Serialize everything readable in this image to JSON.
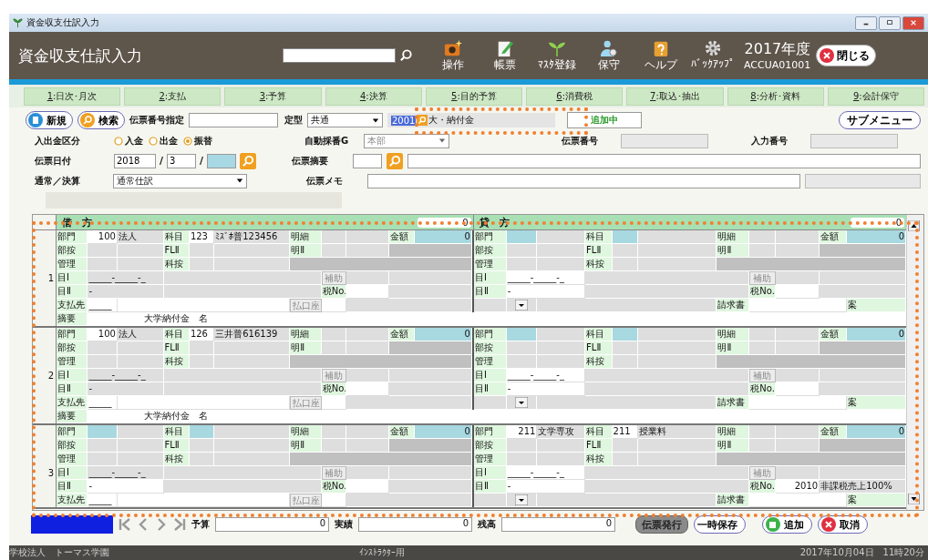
{
  "window": {
    "title": "資金収支仕訳入力"
  },
  "header": {
    "title": "資金収支仕訳入力",
    "tools": [
      {
        "label": "操作"
      },
      {
        "label": "帳票"
      },
      {
        "label": "ﾏｽﾀ登録"
      },
      {
        "label": "保守"
      },
      {
        "label": "ヘルプ"
      },
      {
        "label": "ﾊﾞｯｸｱｯﾌﾟ"
      }
    ],
    "fiscal_year": "2017年度",
    "screen_code": "ACCUA01001",
    "close_button": "閉じる"
  },
  "tabs": [
    {
      "key": "1",
      "label": ":日次･月次",
      "selected": false
    },
    {
      "key": "2",
      "label": ":支払",
      "selected": false
    },
    {
      "key": "3",
      "label": ":予算",
      "selected": false
    },
    {
      "key": "4",
      "label": ":決算",
      "selected": false
    },
    {
      "key": "5",
      "label": ":目的予算",
      "selected": false
    },
    {
      "key": "6",
      "label": ":消費税",
      "selected": false
    },
    {
      "key": "7",
      "label": ":取込･抽出",
      "selected": false
    },
    {
      "key": "8",
      "label": ":分析･資料",
      "selected": false
    },
    {
      "key": "9",
      "label": ":会計保守",
      "selected": false
    }
  ],
  "form": {
    "new_button": "新規",
    "search_button": "検索",
    "voucher_no_label": "伝票番号指定",
    "template_label": "定型",
    "template": "共通",
    "template_code": "2001",
    "template_name": "大・納付金",
    "status": "追加中",
    "submenu_button": "サブメニュー",
    "io_label": "入出金区分",
    "io_options": [
      {
        "label": "入金",
        "selected": false
      },
      {
        "label": "出金",
        "selected": false
      },
      {
        "label": "振替",
        "selected": true
      }
    ],
    "auto_label": "自動採番G",
    "auto_group": "本部",
    "slip_no_label": "伝票番号",
    "input_no_label": "入力番号",
    "date_label": "伝票日付",
    "year": "2018",
    "sep1": "/",
    "month": "3",
    "sep2": "/",
    "summary_label": "伝票摘要",
    "type_label": "通常／決算",
    "type": "通常仕訳",
    "memo_label": "伝票メモ"
  },
  "grid": {
    "debit_label": "借　方",
    "debit_total": "0",
    "credit_label": "貸　方",
    "credit_total": "0",
    "entries": [
      {
        "number": "1",
        "debit": [
          [
            {
              "kind": "label",
              "text": "部門"
            },
            {
              "kind": "number",
              "text": "100"
            },
            {
              "kind": "field",
              "text": "法人"
            },
            {
              "kind": "label",
              "text": "科目"
            },
            {
              "kind": "input",
              "text": "123"
            },
            {
              "kind": "field",
              "text": "ﾐｽﾞﾎ普123456"
            },
            {
              "kind": "label",
              "text": "明細"
            },
            {
              "kind": "field"
            },
            {
              "kind": "field"
            },
            {
              "kind": "label",
              "text": "金額"
            },
            {
              "kind": "amount",
              "text": "0"
            }
          ],
          [
            {
              "kind": "label",
              "text": "部按"
            },
            {
              "kind": "field"
            },
            {
              "kind": "field"
            },
            {
              "kind": "label",
              "text": "FLⅡ"
            },
            {
              "kind": "field"
            },
            {
              "kind": "field"
            },
            {
              "kind": "label",
              "text": "明Ⅱ"
            },
            {
              "kind": "field"
            },
            {
              "kind": "field"
            },
            {
              "kind": "dark"
            }
          ],
          [
            {
              "kind": "label",
              "text": "管理"
            },
            {
              "kind": "field"
            },
            {
              "kind": "field"
            },
            {
              "kind": "label",
              "text": "科按"
            },
            {
              "kind": "field"
            },
            {
              "kind": "field"
            },
            {
              "kind": "dark"
            }
          ],
          [
            {
              "kind": "label",
              "text": "目Ⅰ"
            },
            {
              "kind": "field",
              "text": "_____-_____-_"
            },
            {
              "kind": "field"
            },
            {
              "kind": "button",
              "text": "補助"
            },
            {
              "kind": "field"
            },
            {
              "kind": "field"
            }
          ],
          [
            {
              "kind": "label",
              "text": "目Ⅱ"
            },
            {
              "kind": "field",
              "text": "-"
            },
            {
              "kind": "field"
            },
            {
              "kind": "label",
              "text": "税No."
            },
            {
              "kind": "input"
            },
            {
              "kind": "field"
            }
          ],
          [
            {
              "kind": "label",
              "text": "支払先"
            },
            {
              "kind": "input",
              "text": "_____"
            },
            {
              "kind": "input"
            },
            {
              "kind": "button",
              "text": "払口座"
            },
            {
              "kind": "input"
            },
            {
              "kind": "field"
            }
          ]
        ],
        "credit": [
          [
            {
              "kind": "label",
              "text": "部門"
            },
            {
              "kind": "tinted"
            },
            {
              "kind": "field"
            },
            {
              "kind": "label",
              "text": "科目"
            },
            {
              "kind": "tinted"
            },
            {
              "kind": "field"
            },
            {
              "kind": "label",
              "text": "明細"
            },
            {
              "kind": "field"
            },
            {
              "kind": "field"
            },
            {
              "kind": "label",
              "text": "金額"
            },
            {
              "kind": "amount",
              "text": "0"
            }
          ],
          [
            {
              "kind": "label",
              "text": "部按"
            },
            {
              "kind": "field"
            },
            {
              "kind": "field"
            },
            {
              "kind": "label",
              "text": "FLⅡ"
            },
            {
              "kind": "field"
            },
            {
              "kind": "field"
            },
            {
              "kind": "label",
              "text": "明Ⅱ"
            },
            {
              "kind": "field"
            },
            {
              "kind": "field"
            },
            {
              "kind": "dark"
            }
          ],
          [
            {
              "kind": "label",
              "text": "管理"
            },
            {
              "kind": "field"
            },
            {
              "kind": "field"
            },
            {
              "kind": "label",
              "text": "科按"
            },
            {
              "kind": "field"
            },
            {
              "kind": "field"
            },
            {
              "kind": "dark"
            }
          ],
          [
            {
              "kind": "label",
              "text": "目Ⅰ"
            },
            {
              "kind": "input",
              "text": "_____-_____-_"
            },
            {
              "kind": "field"
            },
            {
              "kind": "button",
              "text": "補助"
            },
            {
              "kind": "field"
            },
            {
              "kind": "field"
            }
          ],
          [
            {
              "kind": "label",
              "text": "目Ⅱ"
            },
            {
              "kind": "input",
              "text": "-"
            },
            {
              "kind": "field"
            },
            {
              "kind": "label",
              "text": "税No."
            },
            {
              "kind": "input"
            },
            {
              "kind": "field"
            }
          ],
          [
            {
              "kind": "field"
            },
            {
              "kind": "dropdown"
            },
            {
              "kind": "field"
            },
            {
              "kind": "label",
              "text": "請求書"
            },
            {
              "kind": "input"
            },
            {
              "kind": "label",
              "text": "案"
            }
          ]
        ],
        "summary": {
          "label": "摘要",
          "text": "大学納付金　名"
        }
      },
      {
        "number": "2",
        "debit": [
          [
            {
              "kind": "label",
              "text": "部門"
            },
            {
              "kind": "number",
              "text": "100"
            },
            {
              "kind": "field",
              "text": "法人"
            },
            {
              "kind": "label",
              "text": "科目"
            },
            {
              "kind": "input",
              "text": "126"
            },
            {
              "kind": "field",
              "text": "三井普616139"
            },
            {
              "kind": "label",
              "text": "明細"
            },
            {
              "kind": "field"
            },
            {
              "kind": "field"
            },
            {
              "kind": "label",
              "text": "金額"
            },
            {
              "kind": "amount",
              "text": "0"
            }
          ],
          [
            {
              "kind": "label",
              "text": "部按"
            },
            {
              "kind": "field"
            },
            {
              "kind": "field"
            },
            {
              "kind": "label",
              "text": "FLⅡ"
            },
            {
              "kind": "field"
            },
            {
              "kind": "field"
            },
            {
              "kind": "label",
              "text": "明Ⅱ"
            },
            {
              "kind": "field"
            },
            {
              "kind": "field"
            },
            {
              "kind": "dark"
            }
          ],
          [
            {
              "kind": "label",
              "text": "管理"
            },
            {
              "kind": "field"
            },
            {
              "kind": "field"
            },
            {
              "kind": "label",
              "text": "科按"
            },
            {
              "kind": "field"
            },
            {
              "kind": "field"
            },
            {
              "kind": "dark"
            }
          ],
          [
            {
              "kind": "label",
              "text": "目Ⅰ"
            },
            {
              "kind": "field",
              "text": "_____-_____-_"
            },
            {
              "kind": "field"
            },
            {
              "kind": "button",
              "text": "補助"
            },
            {
              "kind": "field"
            },
            {
              "kind": "field"
            }
          ],
          [
            {
              "kind": "label",
              "text": "目Ⅱ"
            },
            {
              "kind": "field",
              "text": "-"
            },
            {
              "kind": "field"
            },
            {
              "kind": "label",
              "text": "税No."
            },
            {
              "kind": "input"
            },
            {
              "kind": "field"
            }
          ],
          [
            {
              "kind": "label",
              "text": "支払先"
            },
            {
              "kind": "input",
              "text": "_____"
            },
            {
              "kind": "input"
            },
            {
              "kind": "button",
              "text": "払口座"
            },
            {
              "kind": "input"
            },
            {
              "kind": "field"
            }
          ]
        ],
        "credit": [
          [
            {
              "kind": "label",
              "text": "部門"
            },
            {
              "kind": "tinted"
            },
            {
              "kind": "field"
            },
            {
              "kind": "label",
              "text": "科目"
            },
            {
              "kind": "tinted"
            },
            {
              "kind": "field"
            },
            {
              "kind": "label",
              "text": "明細"
            },
            {
              "kind": "field"
            },
            {
              "kind": "field"
            },
            {
              "kind": "label",
              "text": "金額"
            },
            {
              "kind": "amount",
              "text": "0"
            }
          ],
          [
            {
              "kind": "label",
              "text": "部按"
            },
            {
              "kind": "field"
            },
            {
              "kind": "field"
            },
            {
              "kind": "label",
              "text": "FLⅡ"
            },
            {
              "kind": "field"
            },
            {
              "kind": "field"
            },
            {
              "kind": "label",
              "text": "明Ⅱ"
            },
            {
              "kind": "field"
            },
            {
              "kind": "field"
            },
            {
              "kind": "dark"
            }
          ],
          [
            {
              "kind": "label",
              "text": "管理"
            },
            {
              "kind": "field"
            },
            {
              "kind": "field"
            },
            {
              "kind": "label",
              "text": "科按"
            },
            {
              "kind": "field"
            },
            {
              "kind": "field"
            },
            {
              "kind": "dark"
            }
          ],
          [
            {
              "kind": "label",
              "text": "目Ⅰ"
            },
            {
              "kind": "input",
              "text": "_____-_____-_"
            },
            {
              "kind": "field"
            },
            {
              "kind": "button",
              "text": "補助"
            },
            {
              "kind": "field"
            },
            {
              "kind": "field"
            }
          ],
          [
            {
              "kind": "label",
              "text": "目Ⅱ"
            },
            {
              "kind": "input",
              "text": "-"
            },
            {
              "kind": "field"
            },
            {
              "kind": "label",
              "text": "税No."
            },
            {
              "kind": "input"
            },
            {
              "kind": "field"
            }
          ],
          [
            {
              "kind": "field"
            },
            {
              "kind": "dropdown"
            },
            {
              "kind": "field"
            },
            {
              "kind": "label",
              "text": "請求書"
            },
            {
              "kind": "input"
            },
            {
              "kind": "label",
              "text": "案"
            }
          ]
        ],
        "summary": {
          "label": "摘要",
          "text": "大学納付金　名"
        }
      },
      {
        "number": "3",
        "debit": [
          [
            {
              "kind": "label",
              "text": "部門"
            },
            {
              "kind": "tinted"
            },
            {
              "kind": "field"
            },
            {
              "kind": "label",
              "text": "科目"
            },
            {
              "kind": "tinted"
            },
            {
              "kind": "field"
            },
            {
              "kind": "label",
              "text": "明細"
            },
            {
              "kind": "field"
            },
            {
              "kind": "field"
            },
            {
              "kind": "label",
              "text": "金額"
            },
            {
              "kind": "amount",
              "text": "0"
            }
          ],
          [
            {
              "kind": "label",
              "text": "部按"
            },
            {
              "kind": "field"
            },
            {
              "kind": "field"
            },
            {
              "kind": "label",
              "text": "FLⅡ"
            },
            {
              "kind": "field"
            },
            {
              "kind": "field"
            },
            {
              "kind": "label",
              "text": "明Ⅱ"
            },
            {
              "kind": "field"
            },
            {
              "kind": "field"
            },
            {
              "kind": "dark"
            }
          ],
          [
            {
              "kind": "label",
              "text": "管理"
            },
            {
              "kind": "field"
            },
            {
              "kind": "field"
            },
            {
              "kind": "label",
              "text": "科按"
            },
            {
              "kind": "field"
            },
            {
              "kind": "field"
            },
            {
              "kind": "dark"
            }
          ],
          [
            {
              "kind": "label",
              "text": "目Ⅰ"
            },
            {
              "kind": "field",
              "text": "_____-_____-_"
            },
            {
              "kind": "field"
            },
            {
              "kind": "button",
              "text": "補助"
            },
            {
              "kind": "field"
            },
            {
              "kind": "field"
            }
          ],
          [
            {
              "kind": "label",
              "text": "目Ⅱ"
            },
            {
              "kind": "input",
              "text": "-"
            },
            {
              "kind": "field"
            },
            {
              "kind": "label",
              "text": "税No."
            },
            {
              "kind": "input"
            },
            {
              "kind": "field"
            }
          ],
          [
            {
              "kind": "label",
              "text": "支払先"
            },
            {
              "kind": "input",
              "text": "_____"
            },
            {
              "kind": "input"
            },
            {
              "kind": "button",
              "text": "払口座"
            },
            {
              "kind": "input"
            },
            {
              "kind": "field"
            }
          ]
        ],
        "credit": [
          [
            {
              "kind": "label",
              "text": "部門"
            },
            {
              "kind": "number",
              "text": "211"
            },
            {
              "kind": "field",
              "text": "文学専攻"
            },
            {
              "kind": "label",
              "text": "科目"
            },
            {
              "kind": "input",
              "text": "211"
            },
            {
              "kind": "field",
              "text": "授業料"
            },
            {
              "kind": "label",
              "text": "明細"
            },
            {
              "kind": "field"
            },
            {
              "kind": "field"
            },
            {
              "kind": "label",
              "text": "金額"
            },
            {
              "kind": "amount",
              "text": "0"
            }
          ],
          [
            {
              "kind": "label",
              "text": "部按"
            },
            {
              "kind": "field"
            },
            {
              "kind": "field"
            },
            {
              "kind": "label",
              "text": "FLⅡ"
            },
            {
              "kind": "field"
            },
            {
              "kind": "field"
            },
            {
              "kind": "label",
              "text": "明Ⅱ"
            },
            {
              "kind": "field"
            },
            {
              "kind": "field"
            },
            {
              "kind": "dark"
            }
          ],
          [
            {
              "kind": "label",
              "text": "管理"
            },
            {
              "kind": "field"
            },
            {
              "kind": "field"
            },
            {
              "kind": "label",
              "text": "科按"
            },
            {
              "kind": "field"
            },
            {
              "kind": "field"
            },
            {
              "kind": "dark"
            }
          ],
          [
            {
              "kind": "label",
              "text": "目Ⅰ"
            },
            {
              "kind": "input",
              "text": "_____-_____-_"
            },
            {
              "kind": "field"
            },
            {
              "kind": "button",
              "text": "補助"
            },
            {
              "kind": "field"
            },
            {
              "kind": "field"
            }
          ],
          [
            {
              "kind": "label",
              "text": "目Ⅱ"
            },
            {
              "kind": "input",
              "text": "-"
            },
            {
              "kind": "field"
            },
            {
              "kind": "label",
              "text": "税No."
            },
            {
              "kind": "number",
              "text": "2010"
            },
            {
              "kind": "field",
              "text": "非課税売上100%"
            }
          ],
          [
            {
              "kind": "field"
            },
            {
              "kind": "dropdown"
            },
            {
              "kind": "field"
            },
            {
              "kind": "label",
              "text": "請求書"
            },
            {
              "kind": "input"
            },
            {
              "kind": "label",
              "text": "案"
            }
          ]
        ]
      }
    ]
  },
  "footer": {
    "budget_label": "予算",
    "budget": "0",
    "actual_label": "実績",
    "actual": "0",
    "balance_label": "残高",
    "balance": "0",
    "issue_button": "伝票発行",
    "hold_button": "一時保存",
    "add_button": "追加",
    "cancel_button": "取消"
  },
  "status_bar": {
    "org": "学校法人　トーマス学園",
    "role": "ｲﾝｽﾄﾗｸﾀｰ用",
    "datetime": "2017年10月04日　11時20分"
  }
}
